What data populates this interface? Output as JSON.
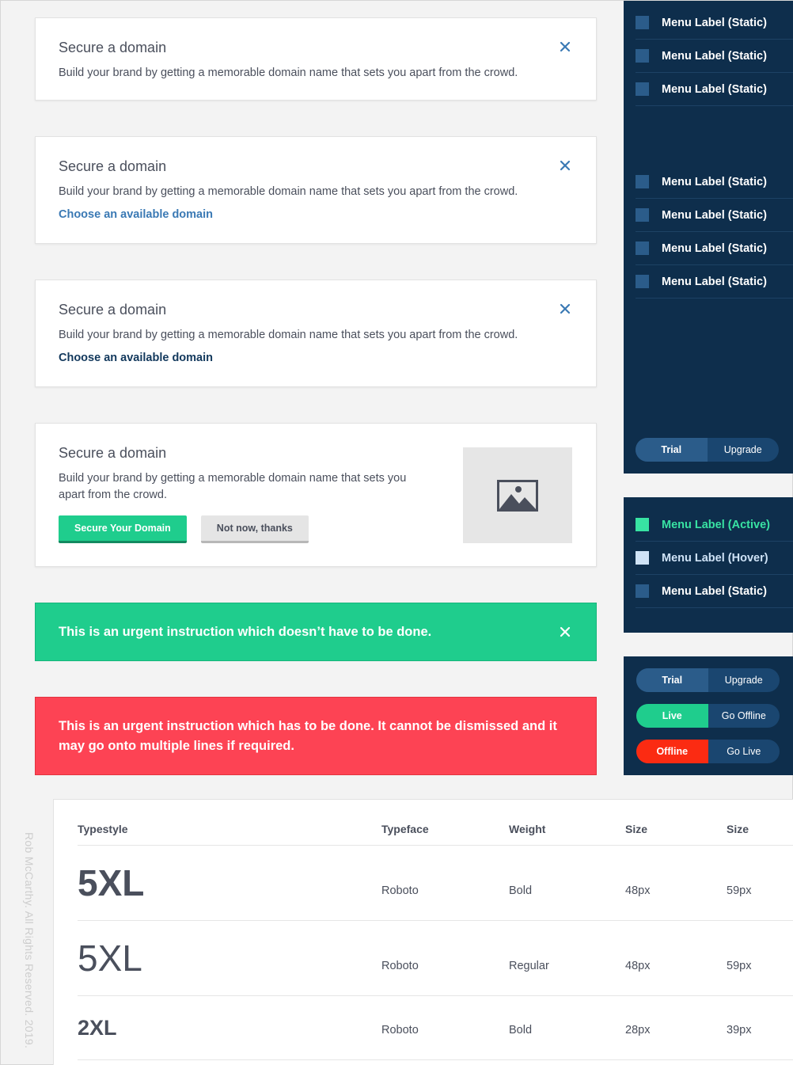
{
  "cards": [
    {
      "title": "Secure a domain",
      "body": "Build your brand by getting a memorable domain name that sets you apart from the crowd."
    },
    {
      "title": "Secure a domain",
      "body": "Build your brand by getting a memorable domain name that sets you apart from the crowd.",
      "link": "Choose an available domain",
      "link_color": "#3a79b4"
    },
    {
      "title": "Secure a domain",
      "body": "Build your brand by getting a memorable domain name that sets you apart from the crowd.",
      "link": "Choose an available domain",
      "link_color": "#12385c"
    },
    {
      "title": "Secure a domain",
      "body": "Build your brand by getting a memorable domain name that sets you apart from the crowd.",
      "primary_button": "Secure Your Domain",
      "secondary_button": "Not now, thanks",
      "image_icon": "image-placeholder-icon"
    }
  ],
  "alerts": {
    "green": "This is an urgent instruction which doesn’t have to be done.",
    "red": "This is an urgent instruction which has to be done. It cannot be dismissed and it may go onto multiple lines if required."
  },
  "sidebar": {
    "panel1_group1": [
      "Menu Label (Static)",
      "Menu Label (Static)",
      "Menu Label (Static)"
    ],
    "panel1_group2": [
      "Menu Label (Static)",
      "Menu Label (Static)",
      "Menu Label (Static)",
      "Menu Label (Static)"
    ],
    "panel1_toggle": {
      "left": "Trial",
      "right": "Upgrade"
    },
    "panel2_items": [
      {
        "label": "Menu Label (Active)",
        "state": "active"
      },
      {
        "label": "Menu Label (Hover)",
        "state": "hover"
      },
      {
        "label": "Menu Label (Static)",
        "state": "static"
      }
    ],
    "toggles": [
      {
        "left": "Trial",
        "right": "Upgrade",
        "left_color": "#2b5c8a"
      },
      {
        "left": "Live",
        "right": "Go Offline",
        "left_color": "#1fcd8d"
      },
      {
        "left": "Offline",
        "right": "Go Live",
        "left_color": "#fb2b12"
      }
    ]
  },
  "type_table": {
    "headers": [
      "Typestyle",
      "Typeface",
      "Weight",
      "Size",
      "Size"
    ],
    "rows": [
      {
        "style": "5XL",
        "typeface": "Roboto",
        "weight": "Bold",
        "size": "48px",
        "line": "59px"
      },
      {
        "style": "5XL",
        "typeface": "Roboto",
        "weight": "Regular",
        "size": "48px",
        "line": "59px"
      },
      {
        "style": "2XL",
        "typeface": "Roboto",
        "weight": "Bold",
        "size": "28px",
        "line": "39px"
      }
    ]
  },
  "copyright": "Rob McCarthy. All Rights Reserved. 2019.",
  "colors": {
    "brand_navy": "#0e2e4c",
    "success": "#1fcd8d",
    "danger": "#fd4354",
    "menu_active": "#38e3a3",
    "menu_hover": "#cfe3f7",
    "link": "#3a79b4",
    "close_icon": "#3a79b4"
  }
}
